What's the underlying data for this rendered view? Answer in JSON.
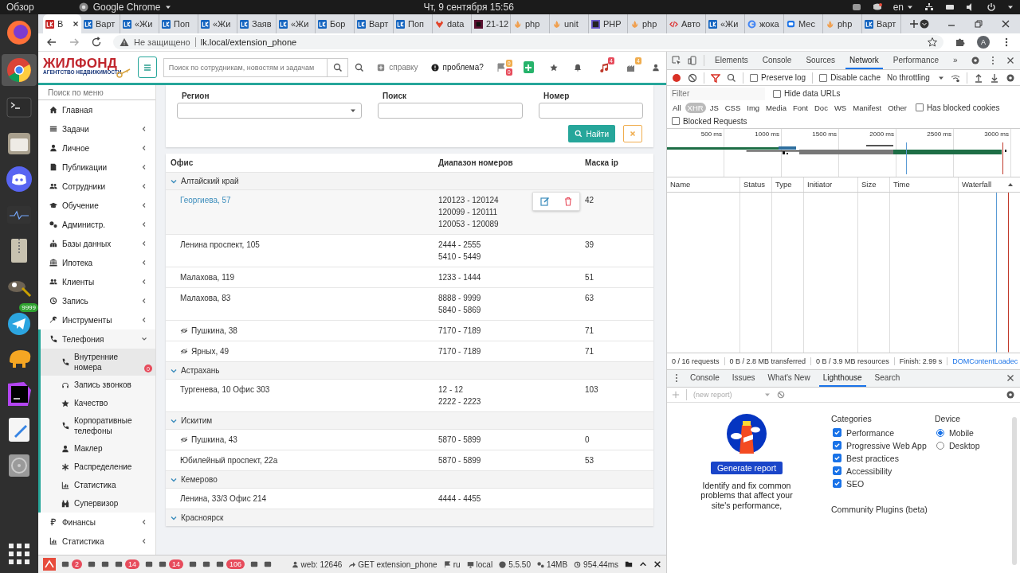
{
  "system_bar": {
    "activities": "Обзор",
    "app": "Google Chrome",
    "clock": "Чт, 9 сентября  15:56",
    "language": "en"
  },
  "dock": {
    "badge": "9999"
  },
  "browser": {
    "tabs": [
      {
        "title": "В",
        "selected": true
      },
      {
        "title": "Варт",
        "selected": false
      },
      {
        "title": "«Жи",
        "selected": false
      },
      {
        "title": "Поп",
        "selected": false
      },
      {
        "title": "«Жи",
        "selected": false
      },
      {
        "title": "Заяв",
        "selected": false
      },
      {
        "title": "«Жи",
        "selected": false
      },
      {
        "title": "Бор",
        "selected": false
      },
      {
        "title": "Варт",
        "selected": false
      },
      {
        "title": "Поп",
        "selected": false
      },
      {
        "title": "data",
        "selected": false
      },
      {
        "title": "21-12",
        "selected": false
      },
      {
        "title": "php",
        "selected": false
      },
      {
        "title": "unit",
        "selected": false
      },
      {
        "title": "PHP",
        "selected": false
      },
      {
        "title": "php",
        "selected": false
      },
      {
        "title": "Авто",
        "selected": false
      },
      {
        "title": "«Жи",
        "selected": false
      },
      {
        "title": "жока",
        "selected": false
      },
      {
        "title": "Мес",
        "selected": false
      },
      {
        "title": "php",
        "selected": false
      },
      {
        "title": "Варт",
        "selected": false
      }
    ],
    "security": "Не защищено",
    "address": "lk.local/extension_phone",
    "profile": "A"
  },
  "site": {
    "logo": {
      "name": "ЖИЛФОНД",
      "tagline": "АГЕНТСТВО НЕДВИЖИМОСТИ"
    },
    "search_placeholder": "Поиск по сотрудникам, новостям и задачам",
    "help": "справку",
    "problem": "проблема?",
    "counters": [
      {
        "count": "0",
        "color": "#f0ad4e"
      },
      {
        "count": "0",
        "color": "#e74c5c"
      }
    ],
    "music_badge": {
      "count": "4",
      "color": "#e74c5c"
    },
    "building_badge": {
      "count": "4",
      "color": "#f0ad4e"
    }
  },
  "sidebar": {
    "search_placeholder": "Поиск по меню",
    "items": [
      {
        "label": "Главная"
      },
      {
        "label": "Задачи",
        "expanded": false
      },
      {
        "label": "Личное",
        "expanded": false
      },
      {
        "label": "Публикации",
        "expanded": false
      },
      {
        "label": "Сотрудники",
        "expanded": false
      },
      {
        "label": "Обучение",
        "expanded": false
      },
      {
        "label": "Администр.",
        "expanded": false
      },
      {
        "label": "Базы данных",
        "expanded": false
      },
      {
        "label": "Ипотека",
        "expanded": false
      },
      {
        "label": "Клиенты",
        "expanded": false
      },
      {
        "label": "Запись",
        "expanded": false
      },
      {
        "label": "Инструменты",
        "expanded": false
      },
      {
        "label": "Телефония",
        "expanded": true,
        "children": [
          {
            "label": "Внутренние номера",
            "selected": true,
            "badge": "0"
          },
          {
            "label": "Запись звонков",
            "selected": false
          },
          {
            "label": "Качество",
            "selected": false
          },
          {
            "label": "Корпоративные телефоны",
            "selected": false
          },
          {
            "label": "Маклер",
            "selected": false
          },
          {
            "label": "Распределение",
            "selected": false
          },
          {
            "label": "Статистика",
            "selected": false
          },
          {
            "label": "Супервизор",
            "selected": false
          }
        ]
      },
      {
        "label": "Финансы",
        "expanded": false
      },
      {
        "label": "Статистика",
        "expanded": false
      }
    ]
  },
  "filter": {
    "fields": [
      {
        "label": "Регион",
        "kind": "select"
      },
      {
        "label": "Поиск",
        "kind": "input"
      },
      {
        "label": "Номер",
        "kind": "input"
      }
    ],
    "submit": "Найти"
  },
  "table": {
    "columns": [
      "Офис",
      "Диапазон номеров",
      "Маска ip"
    ],
    "groups": [
      {
        "name": "Алтайский край",
        "expanded": true,
        "rows": [
          {
            "office": "Георгиева, 57",
            "ranges": [
              "120123 - 120124",
              "120099 - 120111",
              "120053 - 120089"
            ],
            "mask": "42",
            "link": true,
            "hidden": false,
            "hovered": true
          },
          {
            "office": "Ленина проспект, 105",
            "ranges": [
              "2444 - 2555",
              "5410 - 5449"
            ],
            "mask": "39",
            "link": false,
            "hidden": false,
            "hovered": false
          },
          {
            "office": "Малахова, 119",
            "ranges": [
              "1233 - 1444"
            ],
            "mask": "51",
            "link": false,
            "hidden": false,
            "hovered": false
          },
          {
            "office": "Малахова, 83",
            "ranges": [
              "8888 - 9999",
              "5840 - 5869"
            ],
            "mask": "63",
            "link": false,
            "hidden": false,
            "hovered": false
          },
          {
            "office": "Пушкина, 38",
            "ranges": [
              "7170 - 7189"
            ],
            "mask": "71",
            "link": false,
            "hidden": true,
            "hovered": false
          },
          {
            "office": "Ярных, 49",
            "ranges": [
              "7170 - 7189"
            ],
            "mask": "71",
            "link": false,
            "hidden": true,
            "hovered": false
          }
        ]
      },
      {
        "name": "Астрахань",
        "expanded": true,
        "rows": [
          {
            "office": "Тургенева, 10 Офис 303",
            "ranges": [
              "12 - 12",
              "2222 - 2223"
            ],
            "mask": "103",
            "link": false,
            "hidden": false,
            "hovered": false
          }
        ]
      },
      {
        "name": "Искитим",
        "expanded": true,
        "rows": [
          {
            "office": "Пушкина, 43",
            "ranges": [
              "5870 - 5899"
            ],
            "mask": "0",
            "link": false,
            "hidden": true,
            "hovered": false
          },
          {
            "office": "Юбилейный проспект, 22а",
            "ranges": [
              "5870 - 5899"
            ],
            "mask": "53",
            "link": false,
            "hidden": false,
            "hovered": false
          }
        ]
      },
      {
        "name": "Кемерово",
        "expanded": true,
        "rows": [
          {
            "office": "Ленина, 33/3 Офис 214",
            "ranges": [
              "4444 - 4455"
            ],
            "link": false,
            "hidden": false,
            "hovered": false
          }
        ]
      },
      {
        "name": "Красноярск",
        "expanded": true
      }
    ]
  },
  "debug_bar": {
    "counts": [
      "2",
      "14",
      "14",
      "106"
    ],
    "web": "web: 12646",
    "request": "GET extension_phone",
    "locale": "ru",
    "env": "local",
    "version": "5.5.50",
    "memory": "14MB",
    "time": "954.44ms"
  },
  "devtools": {
    "tabs": [
      {
        "label": "Elements",
        "selected": false
      },
      {
        "label": "Console",
        "selected": false
      },
      {
        "label": "Sources",
        "selected": false
      },
      {
        "label": "Network",
        "selected": true
      },
      {
        "label": "Performance",
        "selected": false
      }
    ],
    "more": "»",
    "preserve_log": {
      "label": "Preserve log",
      "checked": false
    },
    "disable_cache": {
      "label": "Disable cache",
      "checked": false
    },
    "throttling": "No throttling",
    "filter_placeholder": "Filter",
    "hide_data_urls": {
      "label": "Hide data URLs",
      "checked": false
    },
    "types": [
      {
        "label": "All",
        "selected": false
      },
      {
        "label": "XHR",
        "selected": true
      },
      {
        "label": "JS",
        "selected": false
      },
      {
        "label": "CSS",
        "selected": false
      },
      {
        "label": "Img",
        "selected": false
      },
      {
        "label": "Media",
        "selected": false
      },
      {
        "label": "Font",
        "selected": false
      },
      {
        "label": "Doc",
        "selected": false
      },
      {
        "label": "WS",
        "selected": false
      },
      {
        "label": "Manifest",
        "selected": false
      },
      {
        "label": "Other",
        "selected": false
      }
    ],
    "blocked_cookies": {
      "label": "Has blocked cookies",
      "checked": false
    },
    "blocked_requests": {
      "label": "Blocked Requests",
      "checked": false
    },
    "ticks": [
      "500 ms",
      "1000 ms",
      "1500 ms",
      "2000 ms",
      "2500 ms",
      "3000 ms"
    ],
    "columns": [
      "Name",
      "Status",
      "Type",
      "Initiator",
      "Size",
      "Time",
      "Waterfall"
    ],
    "status": [
      "0 / 16 requests",
      "0 B / 2.8 MB transferred",
      "0 B / 3.9 MB resources",
      "Finish: 2.99 s"
    ],
    "dom_loaded": "DOMContentLoadec",
    "drawer_tabs": [
      {
        "label": "Console",
        "selected": false
      },
      {
        "label": "Issues",
        "selected": false
      },
      {
        "label": "What's New",
        "selected": false
      },
      {
        "label": "Lighthouse",
        "selected": true
      },
      {
        "label": "Search",
        "selected": false
      }
    ],
    "report": "(new report)",
    "lighthouse": {
      "button": "Generate report",
      "description": "Identify and fix common problems that affect your site's performance,",
      "categories_title": "Categories",
      "categories": [
        {
          "label": "Performance",
          "checked": true
        },
        {
          "label": "Progressive Web App",
          "checked": true
        },
        {
          "label": "Best practices",
          "checked": true
        },
        {
          "label": "Accessibility",
          "checked": true
        },
        {
          "label": "SEO",
          "checked": true
        }
      ],
      "device_title": "Device",
      "devices": [
        {
          "label": "Mobile",
          "selected": true
        },
        {
          "label": "Desktop",
          "selected": false
        }
      ],
      "plugins_title": "Community Plugins (beta)"
    }
  }
}
